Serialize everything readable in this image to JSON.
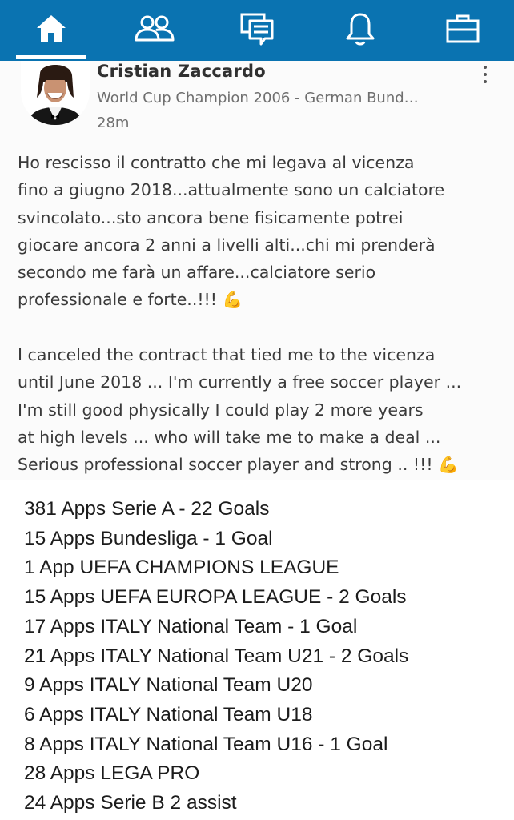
{
  "nav": {
    "items": [
      {
        "icon": "home-icon",
        "active": true
      },
      {
        "icon": "network-icon",
        "active": false
      },
      {
        "icon": "messaging-icon",
        "active": false
      },
      {
        "icon": "notifications-bell-icon",
        "active": false
      },
      {
        "icon": "jobs-briefcase-icon",
        "active": false
      }
    ],
    "background": "#0a73b1"
  },
  "post": {
    "author_name": "Cristian Zaccardo",
    "author_headline": "World Cup Champion 2006 - German Bund…",
    "time": "28m",
    "paragraph_it": [
      "Ho rescisso il contratto che mi legava al vicenza",
      "fino a giugno 2018...attualmente sono un calciatore",
      "svincolato...sto ancora bene fisicamente potrei",
      "giocare ancora 2 anni a livelli alti...chi mi prenderà",
      "secondo me farà un affare...calciatore serio",
      "professionale e forte..!!! 💪"
    ],
    "paragraph_en": [
      "I canceled the contract that tied me to the vicenza",
      "until June 2018 ... I'm currently a free soccer player ...",
      "I'm still good physically I could play 2 more years",
      "at high levels ... who will take me to make a deal ...",
      "Serious professional soccer player and strong .. !!! 💪"
    ]
  },
  "stats": [
    "381 Apps Serie A -  22 Goals",
    "15 Apps Bundesliga - 1 Goal",
    "1 App UEFA CHAMPIONS LEAGUE",
    "15 Apps UEFA EUROPA LEAGUE - 2 Goals",
    "17 Apps ITALY National Team - 1 Goal",
    "21 Apps ITALY National Team U21 - 2 Goals",
    "9 Apps ITALY National Team U20",
    "6 Apps ITALY National Team U18",
    "8 Apps ITALY National Team U16 - 1 Goal",
    "28 Apps LEGA PRO",
    "24 Apps Serie B 2 assist"
  ]
}
